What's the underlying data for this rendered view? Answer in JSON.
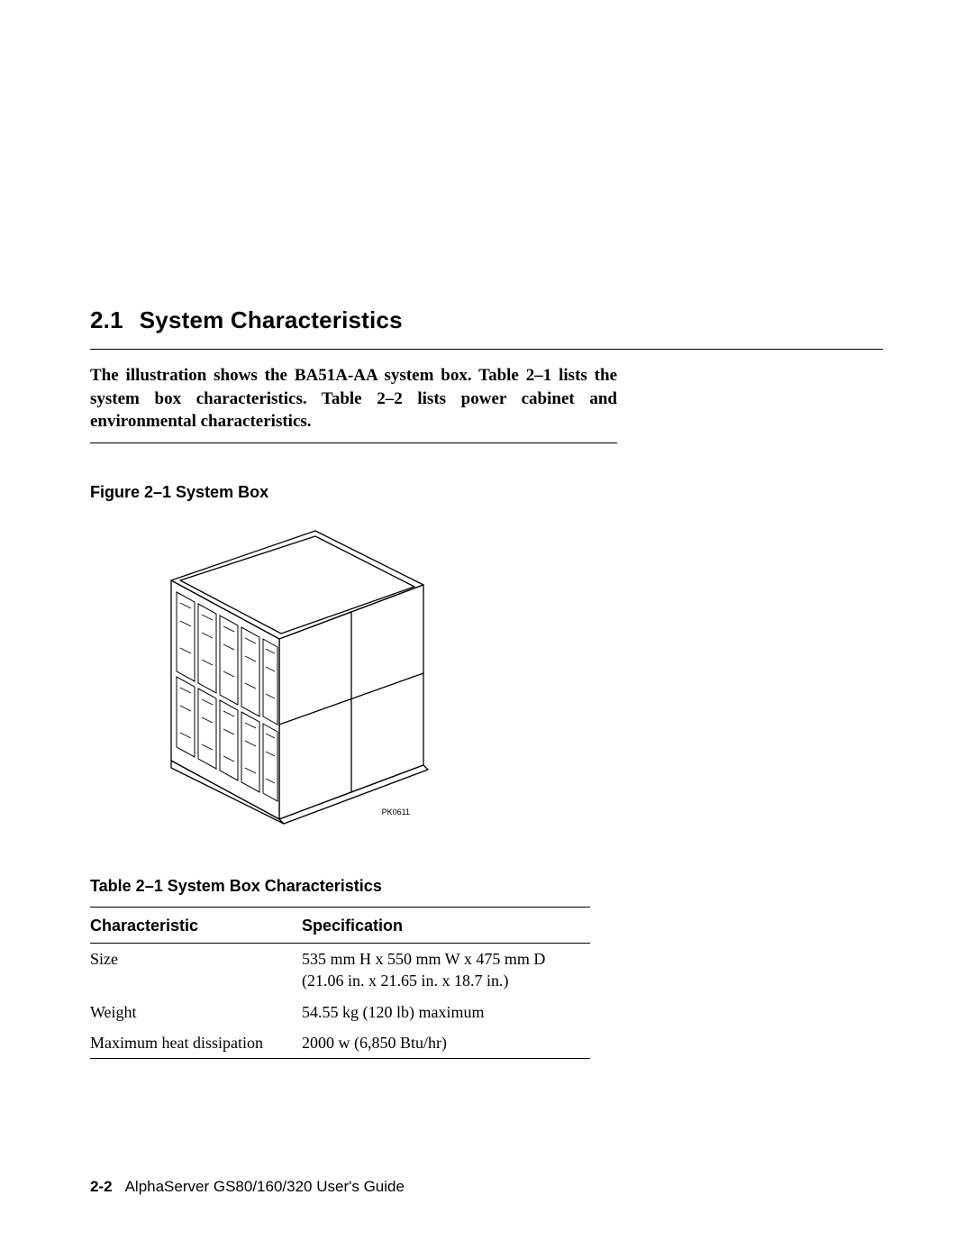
{
  "section": {
    "number": "2.1",
    "title": "System Characteristics"
  },
  "intro": "The illustration shows the BA51A-AA system box. Table 2–1 lists the system box characteristics. Table 2–2 lists power cabinet and environmental characteristics.",
  "figure": {
    "caption": "Figure 2–1  System Box",
    "tag": "PK0611"
  },
  "table": {
    "caption": "Table 2–1 System Box Characteristics",
    "headers": {
      "c1": "Characteristic",
      "c2": "Specification"
    },
    "rows": [
      {
        "c1": "Size",
        "c2": "535 mm H x 550 mm W x 475 mm D\n(21.06 in. x 21.65 in. x 18.7 in.)"
      },
      {
        "c1": "Weight",
        "c2": "54.55 kg (120 lb) maximum"
      },
      {
        "c1": "Maximum heat dissipation",
        "c2": "2000 w (6,850 Btu/hr)"
      }
    ]
  },
  "footer": {
    "page": "2-2",
    "doc_title": "AlphaServer GS80/160/320 User's Guide"
  }
}
